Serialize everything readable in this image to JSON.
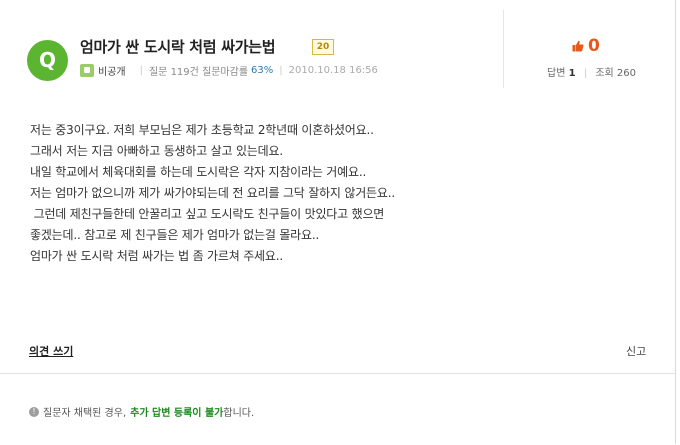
{
  "question": {
    "badge_letter": "Q",
    "title": "엄마가 싼 도시락 처럼 싸가는법",
    "level": "20",
    "author": "비공개",
    "stats_prefix": "질문 119건 질문마감률",
    "close_rate": "63%",
    "date": "2010.10.18 16:56"
  },
  "side": {
    "like_count": "0",
    "answers_label": "답변",
    "answers_count": "1",
    "views_label": "조회",
    "views_count": "260"
  },
  "body": {
    "text": "저는 중3이구요. 저희 부모님은 제가 초등학교 2학년때 이혼하셨어요..\n그래서 저는 지금 아빠하고 동생하고 살고 있는데요.\n내일 학교에서 체육대회를 하는데 도시락은 각자 지참이라는 거예요..\n저는 엄마가 없으니까 제가 싸가야되는데 전 요리를 그닥 잘하지 않거든요..\n 그런데 제친구들한테 안꿀리고 싶고 도시락도 친구들이 맛있다고 했으면\n좋겠는데.. 참고로 제 친구들은 제가 엄마가 없는걸 몰라요..\n엄마가 싼 도시락 처럼 싸가는 법 좀 가르쳐 주세요.."
  },
  "actions": {
    "write_opinion": "의견 쓰기",
    "report": "신고"
  },
  "notice": {
    "prefix": "질문자 채택된 경우,",
    "highlight": "추가 답변 등록이 불가",
    "suffix": "합니다."
  },
  "colors": {
    "brand_green": "#5cb531",
    "like_orange": "#e8581c",
    "notice_green": "#1e8a1e"
  }
}
